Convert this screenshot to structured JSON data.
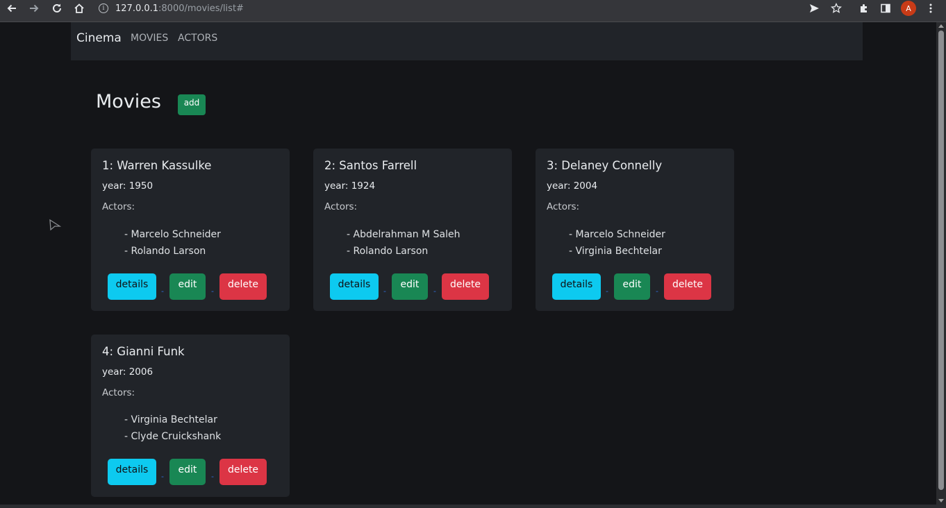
{
  "browser": {
    "url_host": "127.0.0.1",
    "url_path": ":8000/movies/list#",
    "avatar_initial": "A"
  },
  "navbar": {
    "brand": "Cinema",
    "links": [
      "MOVIES",
      "ACTORS"
    ]
  },
  "page": {
    "title": "Movies",
    "add_label": "add"
  },
  "buttons": {
    "details": "details",
    "edit": "edit",
    "delete": "delete",
    "separator": "-"
  },
  "movies": [
    {
      "title": "1: Warren Kassulke",
      "year": "year: 1950",
      "actors_label": "Actors:",
      "actors": [
        "- Marcelo Schneider",
        "- Rolando Larson"
      ]
    },
    {
      "title": "2: Santos Farrell",
      "year": "year: 1924",
      "actors_label": "Actors:",
      "actors": [
        "- Abdelrahman M Saleh",
        "- Rolando Larson"
      ]
    },
    {
      "title": "3: Delaney Connelly",
      "year": "year: 2004",
      "actors_label": "Actors:",
      "actors": [
        "- Marcelo Schneider",
        "- Virginia Bechtelar"
      ]
    },
    {
      "title": "4: Gianni Funk",
      "year": "year: 2006",
      "actors_label": "Actors:",
      "actors": [
        "- Virginia Bechtelar",
        "- Clyde Cruickshank"
      ]
    }
  ]
}
